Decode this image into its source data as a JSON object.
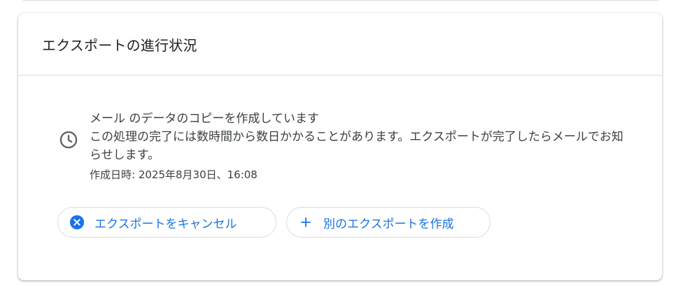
{
  "card": {
    "title": "エクスポートの進行状況"
  },
  "status": {
    "icon": "clock-icon",
    "title": "メール のデータのコピーを作成しています",
    "description": "この処理の完了には数時間から数日かかることがあります。エクスポートが完了したらメールでお知らせします。",
    "created": "作成日時: 2025年8月30日、16:08"
  },
  "actions": {
    "cancel": {
      "label": "エクスポートをキャンセル",
      "icon": "cancel-circle-icon"
    },
    "new_export": {
      "label": "別のエクスポートを作成",
      "icon": "plus-icon"
    }
  },
  "colors": {
    "accent": "#1a73e8",
    "text": "#3c4043",
    "border": "#dadce0"
  }
}
